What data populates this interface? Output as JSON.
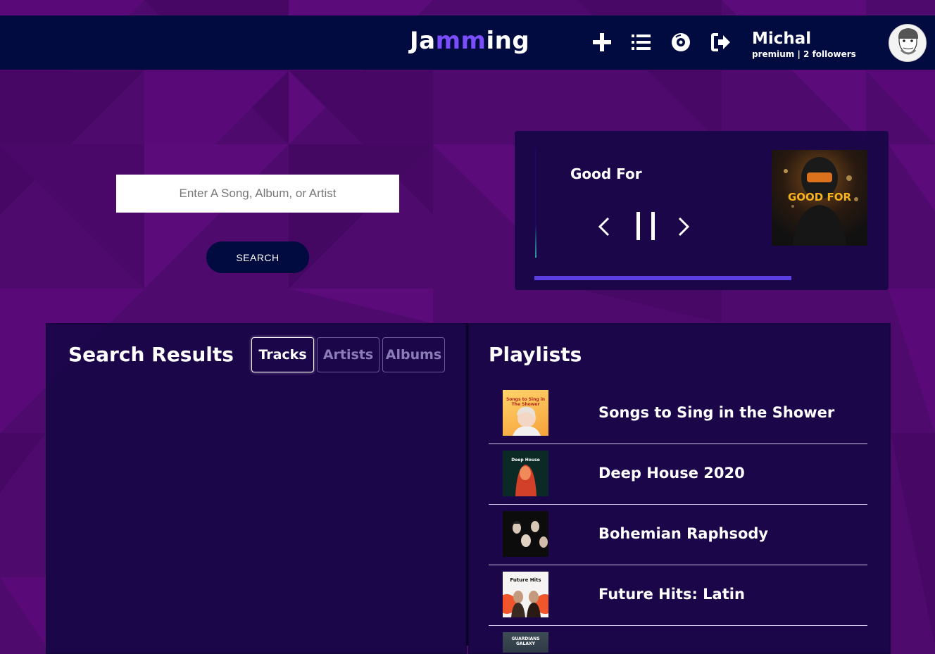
{
  "app": {
    "logo_part1": "Ja",
    "logo_part2": "mm",
    "logo_part3": "ing"
  },
  "nav": {
    "icons": [
      "plus-icon",
      "list-icon",
      "vinyl-icon",
      "logout-icon"
    ]
  },
  "user": {
    "name": "Michal",
    "subtitle": "premium | 2 followers"
  },
  "search": {
    "placeholder": "Enter A Song, Album, or Artist",
    "button_label": "SEARCH"
  },
  "player": {
    "track_title": "Good For",
    "album_art_text": "GOOD FOR",
    "progress": 0.78,
    "state": "playing"
  },
  "results": {
    "title": "Search Results",
    "tabs": [
      {
        "label": "Tracks",
        "active": true
      },
      {
        "label": "Artists",
        "active": false
      },
      {
        "label": "Albums",
        "active": false
      }
    ]
  },
  "playlists": {
    "title": "Playlists",
    "items": [
      {
        "name": "Songs to Sing in the Shower",
        "thumb_text": "Songs to Sing in The Shower"
      },
      {
        "name": "Deep House 2020",
        "thumb_text": "Deep House"
      },
      {
        "name": "Bohemian Raphsody",
        "thumb_text": ""
      },
      {
        "name": "Future Hits: Latin",
        "thumb_text": "Future Hits"
      },
      {
        "name": "",
        "thumb_text": "GUARDIANS GALAXY"
      }
    ]
  },
  "colors": {
    "background": "#4f0a6e",
    "topbar": "#010b3f",
    "accent": "#7b4dff",
    "panel": "#160646",
    "progress": "#5c3fe2"
  }
}
